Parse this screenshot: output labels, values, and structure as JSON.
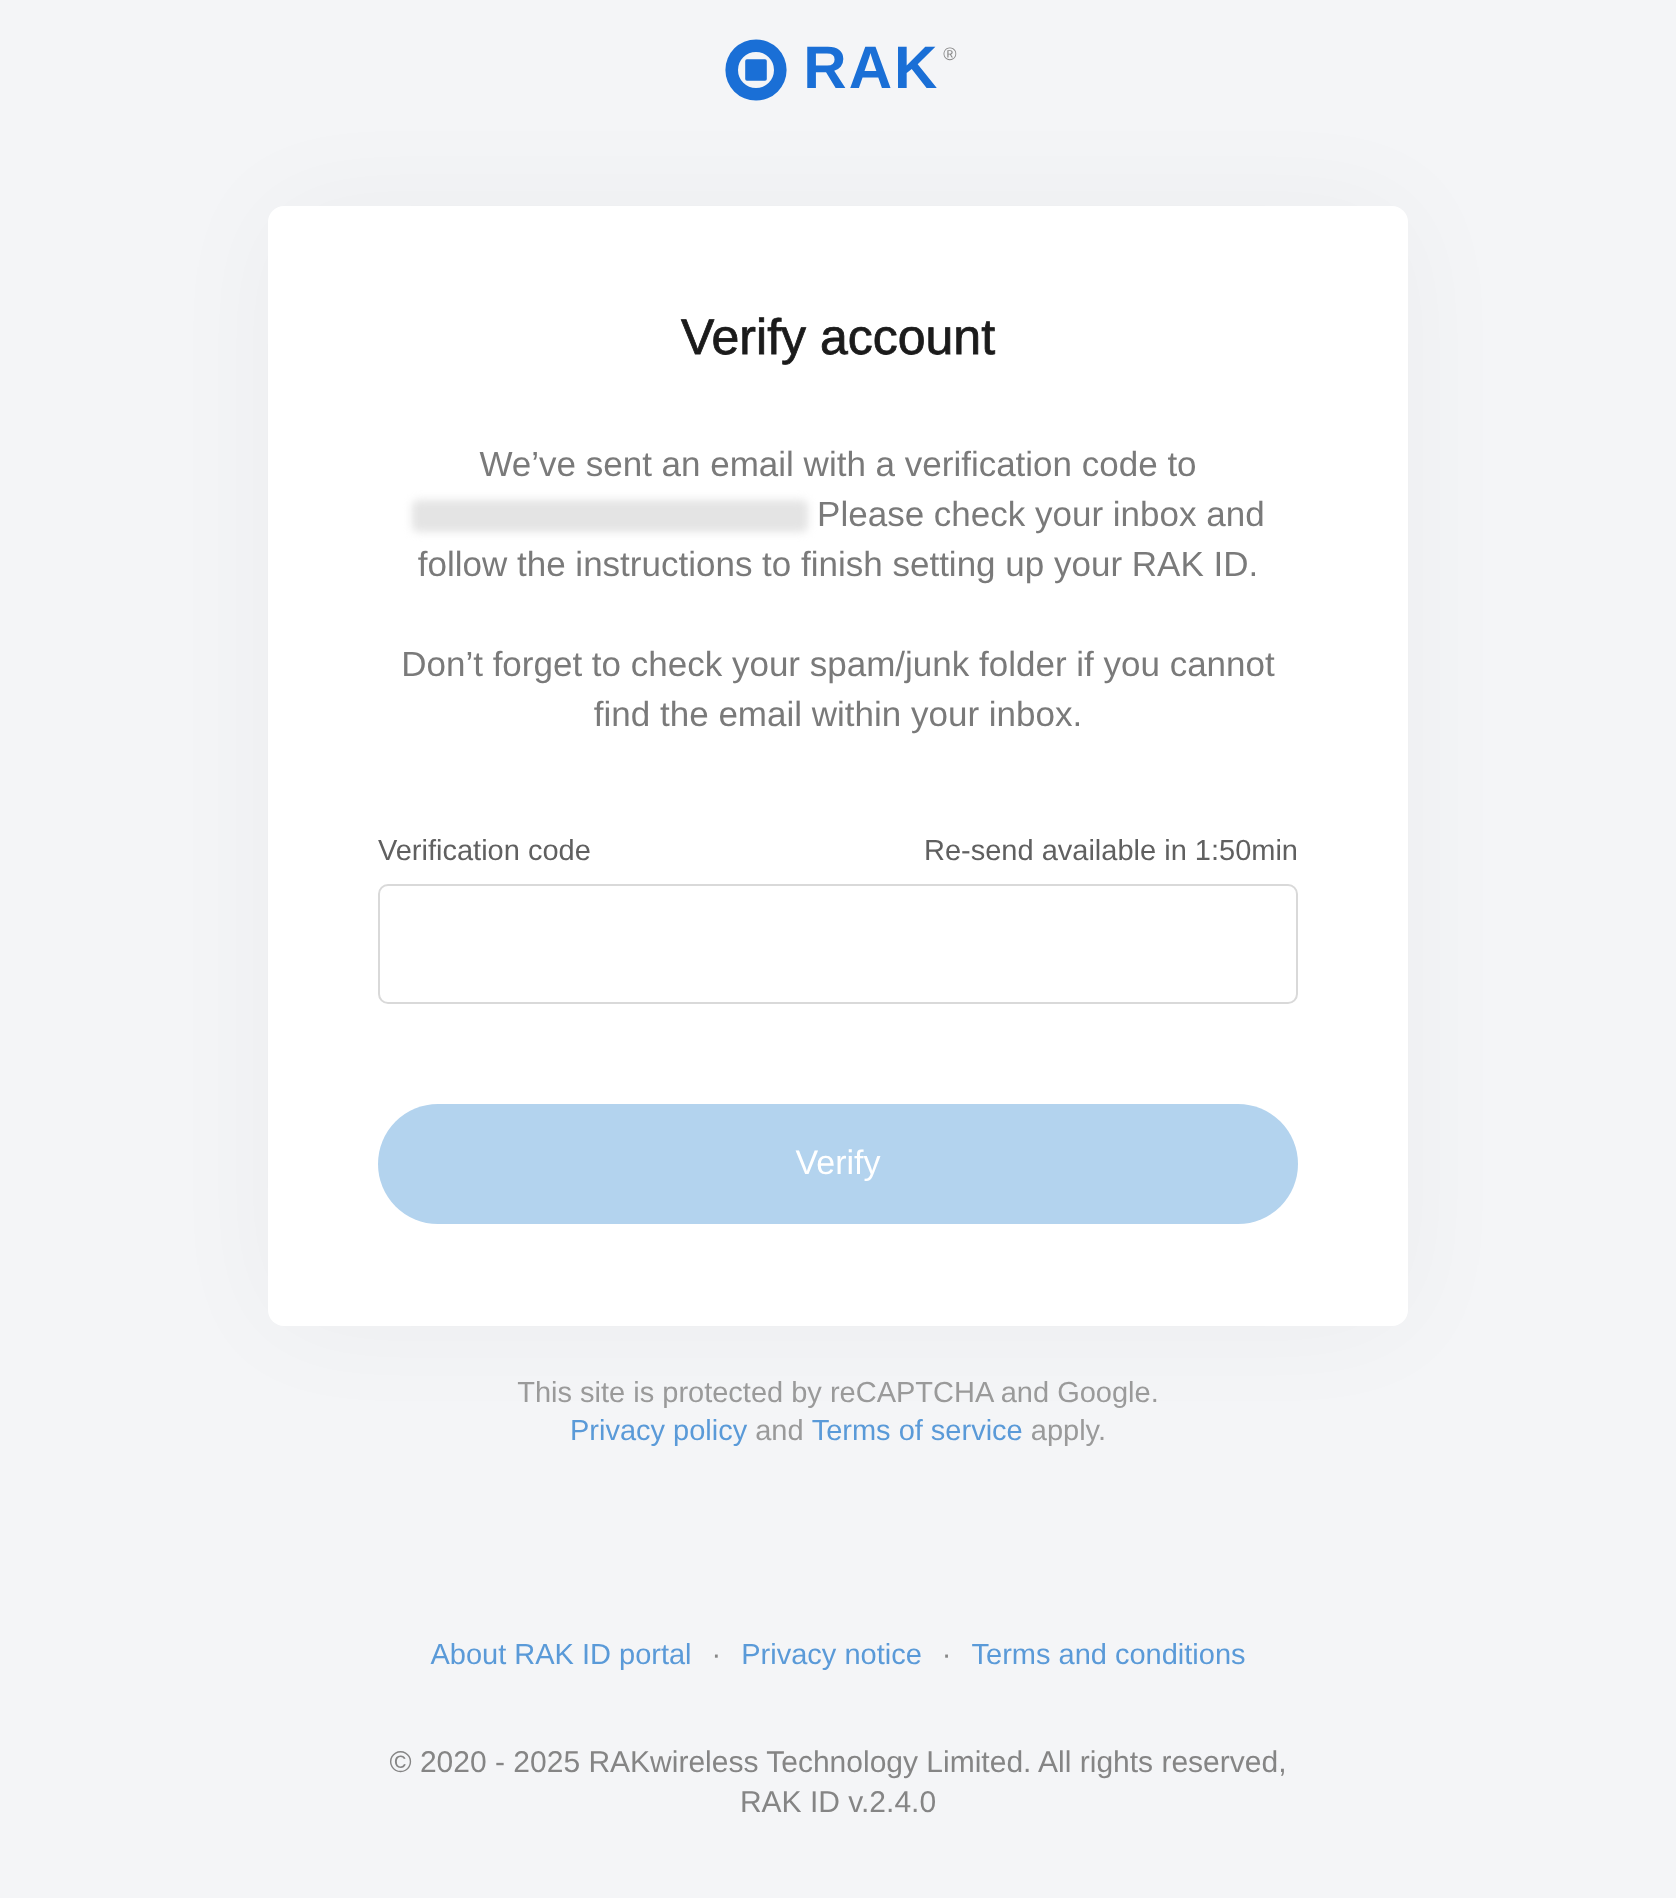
{
  "logo": {
    "text": "RAK",
    "mark": "®"
  },
  "card": {
    "title": "Verify account",
    "message_before": "We’ve sent an email with a verification code to",
    "message_after": "Please check your inbox and follow the instructions to finish setting up your RAK ID.",
    "note": "Don’t forget to check your spam/junk folder if you cannot find the email within your inbox.",
    "field": {
      "label": "Verification code",
      "resend": "Re-send available in 1:50min"
    },
    "button": {
      "label": "Verify",
      "disabled": true
    }
  },
  "recaptcha": {
    "text": "This site is protected by reCAPTCHA and Google.",
    "link1": "Privacy policy",
    "joiner": "and",
    "link2": "Terms of service",
    "tail": "apply."
  },
  "footer_links": [
    "About RAK ID portal",
    "Privacy notice",
    "Terms and conditions"
  ],
  "separator": "·",
  "copyright": "© 2020 - 2025 RAKwireless Technology Limited. All rights reserved,",
  "version": "RAK ID v.2.4.0"
}
